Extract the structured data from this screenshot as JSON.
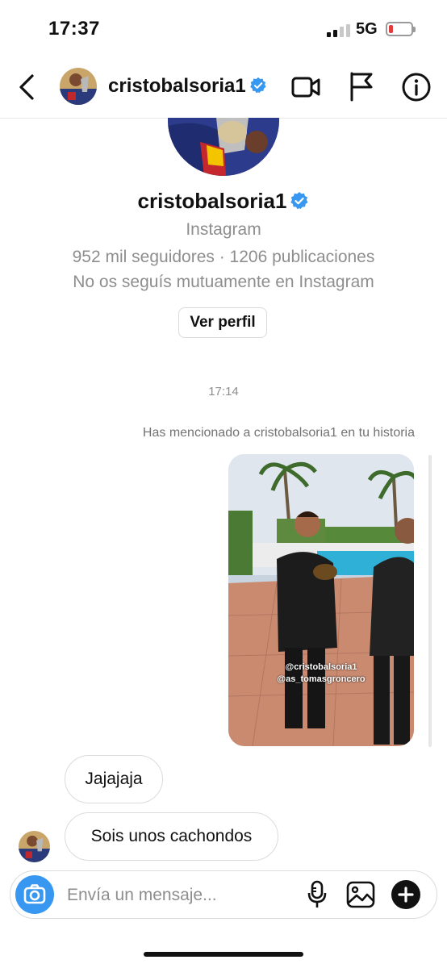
{
  "status": {
    "time": "17:37",
    "network": "5G"
  },
  "header": {
    "username": "cristobalsoria1"
  },
  "profile": {
    "name": "cristobalsoria1",
    "platform": "Instagram",
    "stats": "952 mil seguidores · 1206 publicaciones",
    "follow_status": "No os seguís mutuamente en Instagram",
    "view_profile_label": "Ver perfil"
  },
  "chat": {
    "timestamp": "17:14",
    "mention_note": "Has mencionado a cristobalsoria1 en tu historia",
    "story": {
      "tags": [
        "@cristobalsoria1",
        "@as_tomasgroncero"
      ]
    },
    "messages": [
      {
        "text": "Jajajaja"
      },
      {
        "text": "Sois unos cachondos"
      }
    ]
  },
  "composer": {
    "placeholder": "Envía un mensaje..."
  },
  "colors": {
    "accent": "#3897f0",
    "verified": "#3897f0",
    "battery_low": "#e23b3b"
  }
}
